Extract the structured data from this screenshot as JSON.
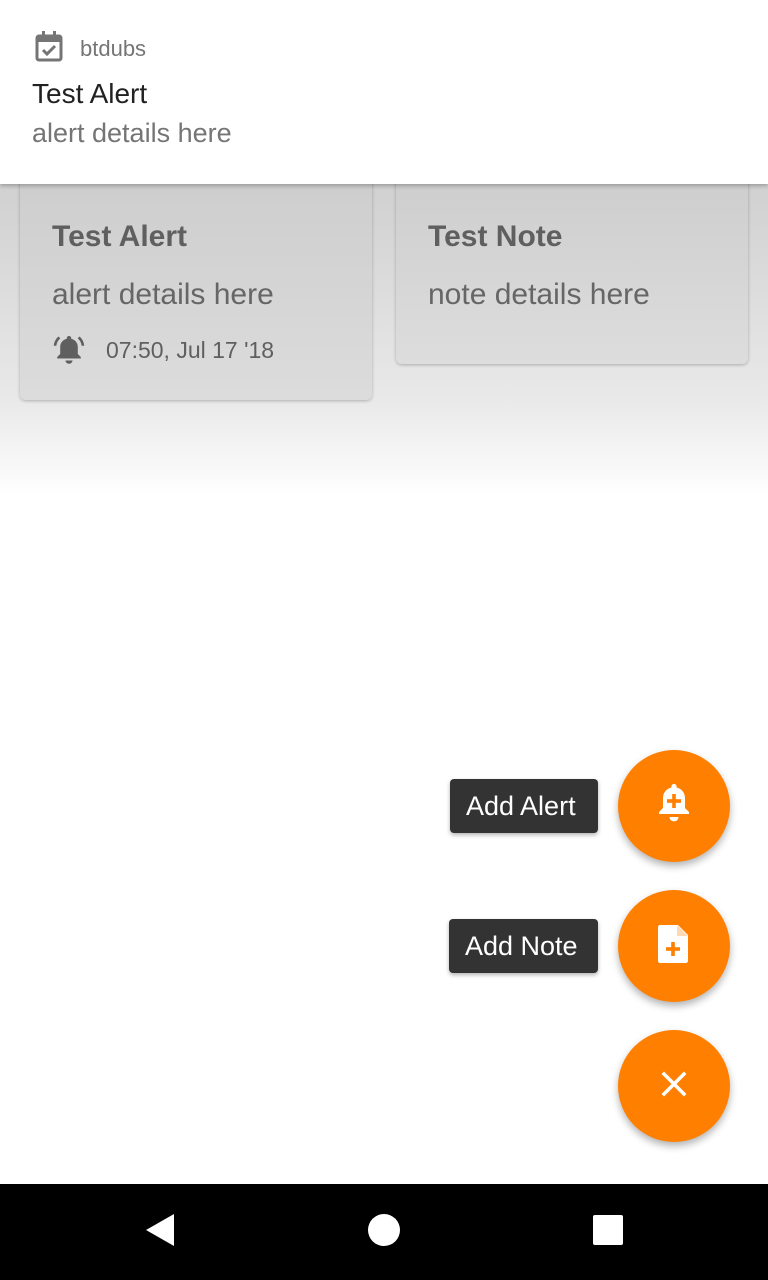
{
  "notification": {
    "app_name": "btdubs",
    "app_icon": "calendar-check-icon",
    "title": "Test Alert",
    "text": "alert details here"
  },
  "cards": {
    "alert": {
      "title": "Test Alert",
      "details": "alert details here",
      "time": "07:50, Jul 17 '18",
      "icon": "alarm-icon"
    },
    "note": {
      "title": "Test Note",
      "details": "note details here"
    }
  },
  "fab_menu": {
    "add_alert_label": "Add Alert",
    "add_alert_icon": "add-alert-icon",
    "add_note_label": "Add Note",
    "add_note_icon": "note-add-icon",
    "close_icon": "close-icon",
    "accent_color": "#ff7f00"
  },
  "navbar": {
    "back_icon": "back-icon",
    "home_icon": "home-icon",
    "recents_icon": "recents-icon"
  }
}
